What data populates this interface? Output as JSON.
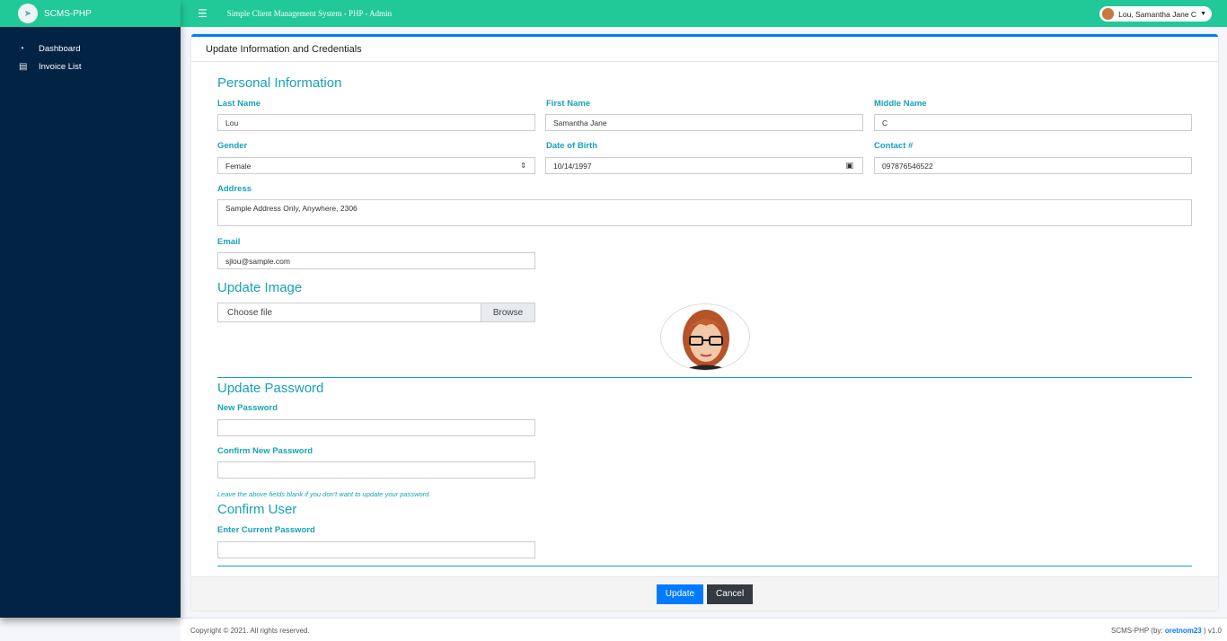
{
  "brand": {
    "name": "SCMS-PHP"
  },
  "sidebar": {
    "items": [
      {
        "label": "Dashboard",
        "icon": "tachometer-icon"
      },
      {
        "label": "Invoice List",
        "icon": "file-invoice-icon"
      }
    ]
  },
  "header": {
    "title": "Simple Client Management System - PHP - Admin",
    "user_name": "Lou, Samantha Jane C"
  },
  "card": {
    "title": "Update Information and Credentials"
  },
  "personal": {
    "section_title": "Personal Information",
    "last_name_label": "Last Name",
    "last_name": "Lou",
    "first_name_label": "First Name",
    "first_name": "Samantha Jane",
    "middle_name_label": "Middle Name",
    "middle_name": "C",
    "gender_label": "Gender",
    "gender": "Female",
    "dob_label": "Date of Birth",
    "dob": "10/14/1997",
    "contact_label": "Contact #",
    "contact": "097876546522",
    "address_label": "Address",
    "address": "Sample Address Only, Anywhere, 2306",
    "email_label": "Email",
    "email": "sjlou@sample.com"
  },
  "image": {
    "section_title": "Update Image",
    "choose_file": "Choose file",
    "browse": "Browse"
  },
  "password": {
    "section_title": "Update Password",
    "new_label": "New Password",
    "confirm_label": "Confirm New Password",
    "hint": "Leave the above fields blank if you don't want to update your password."
  },
  "confirm_user": {
    "section_title": "Confirm User",
    "current_label": "Enter Current Password"
  },
  "buttons": {
    "update": "Update",
    "cancel": "Cancel"
  },
  "footer": {
    "copyright": "Copyright © 2021. All rights reserved.",
    "credit_prefix": "SCMS-PHP (by: ",
    "credit_link": "oretnom23",
    "credit_suffix": " ) v1.0"
  },
  "colors": {
    "accent": "#20c997",
    "sidebar": "#022343",
    "primary": "#007bff",
    "info": "#17a2b8"
  }
}
